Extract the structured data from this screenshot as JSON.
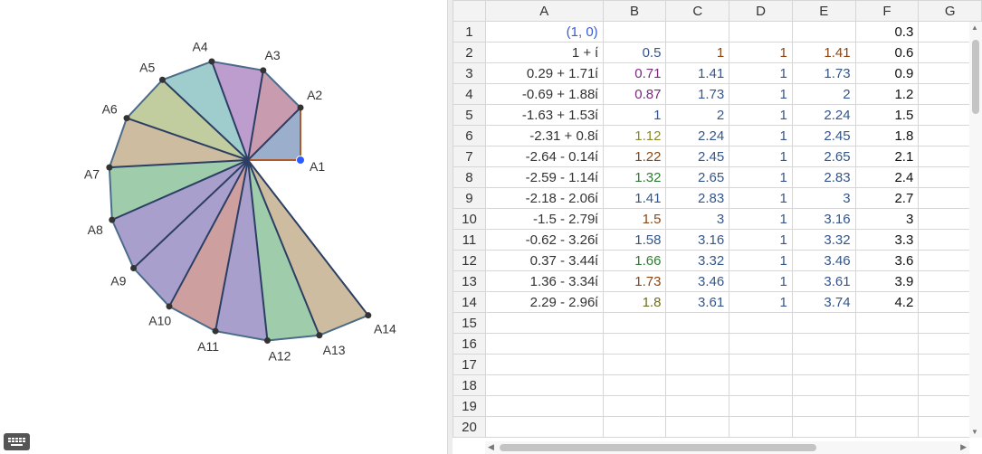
{
  "graphics": {
    "colors": {
      "edge": "#4a6b8a",
      "spoke": "#2c3e63",
      "point": "#333333",
      "selected_point": "#2d5bff",
      "first_triangle_edge": "#b05a2a",
      "fills": [
        "#8aa1c4",
        "#bf8aa0",
        "#b28cc4",
        "#8ec4c4",
        "#b6c48e",
        "#c4b08e",
        "#8ec49e",
        "#9a8ec4",
        "#9a8ec4",
        "#c48e8e",
        "#9a8ec4",
        "#8ec49e",
        "#c4b08e",
        "#b6c48e"
      ]
    },
    "points": [
      {
        "label": "A1",
        "selected": true
      },
      {
        "label": "A2"
      },
      {
        "label": "A3"
      },
      {
        "label": "A4"
      },
      {
        "label": "A5"
      },
      {
        "label": "A6"
      },
      {
        "label": "A7"
      },
      {
        "label": "A8"
      },
      {
        "label": "A9"
      },
      {
        "label": "A10"
      },
      {
        "label": "A11"
      },
      {
        "label": "A12"
      },
      {
        "label": "A13"
      },
      {
        "label": "A14"
      }
    ]
  },
  "keyboard": {
    "icon": "keyboard-icon"
  },
  "spreadsheet": {
    "columns": [
      "A",
      "B",
      "C",
      "D",
      "E",
      "F",
      "G"
    ],
    "rows": [
      {
        "n": "1",
        "A": "(1, 0)",
        "B": "",
        "C": "",
        "D": "",
        "E": "",
        "F": "0.3"
      },
      {
        "n": "2",
        "A": "1 + ί",
        "B": "0.5",
        "C": "1",
        "D": "1",
        "E": "1.41",
        "F": "0.6"
      },
      {
        "n": "3",
        "A": "0.29 + 1.71ί",
        "B": "0.71",
        "C": "1.41",
        "D": "1",
        "E": "1.73",
        "F": "0.9"
      },
      {
        "n": "4",
        "A": "-0.69 + 1.88ί",
        "B": "0.87",
        "C": "1.73",
        "D": "1",
        "E": "2",
        "F": "1.2"
      },
      {
        "n": "5",
        "A": "-1.63 + 1.53ί",
        "B": "1",
        "C": "2",
        "D": "1",
        "E": "2.24",
        "F": "1.5"
      },
      {
        "n": "6",
        "A": "-2.31 + 0.8ί",
        "B": "1.12",
        "C": "2.24",
        "D": "1",
        "E": "2.45",
        "F": "1.8"
      },
      {
        "n": "7",
        "A": "-2.64 - 0.14ί",
        "B": "1.22",
        "C": "2.45",
        "D": "1",
        "E": "2.65",
        "F": "2.1"
      },
      {
        "n": "8",
        "A": "-2.59 - 1.14ί",
        "B": "1.32",
        "C": "2.65",
        "D": "1",
        "E": "2.83",
        "F": "2.4"
      },
      {
        "n": "9",
        "A": "-2.18 - 2.06ί",
        "B": "1.41",
        "C": "2.83",
        "D": "1",
        "E": "3",
        "F": "2.7"
      },
      {
        "n": "10",
        "A": "-1.5 - 2.79ί",
        "B": "1.5",
        "C": "3",
        "D": "1",
        "E": "3.16",
        "F": "3"
      },
      {
        "n": "11",
        "A": "-0.62 - 3.26ί",
        "B": "1.58",
        "C": "3.16",
        "D": "1",
        "E": "3.32",
        "F": "3.3"
      },
      {
        "n": "12",
        "A": "0.37 - 3.44ί",
        "B": "1.66",
        "C": "3.32",
        "D": "1",
        "E": "3.46",
        "F": "3.6"
      },
      {
        "n": "13",
        "A": "1.36 - 3.34ί",
        "B": "1.73",
        "C": "3.46",
        "D": "1",
        "E": "3.61",
        "F": "3.9"
      },
      {
        "n": "14",
        "A": "2.29 - 2.96ί",
        "B": "1.8",
        "C": "3.61",
        "D": "1",
        "E": "3.74",
        "F": "4.2"
      },
      {
        "n": "15",
        "A": "",
        "B": "",
        "C": "",
        "D": "",
        "E": "",
        "F": ""
      },
      {
        "n": "16",
        "A": "",
        "B": "",
        "C": "",
        "D": "",
        "E": "",
        "F": ""
      },
      {
        "n": "17",
        "A": "",
        "B": "",
        "C": "",
        "D": "",
        "E": "",
        "F": ""
      },
      {
        "n": "18",
        "A": "",
        "B": "",
        "C": "",
        "D": "",
        "E": "",
        "F": ""
      },
      {
        "n": "19",
        "A": "",
        "B": "",
        "C": "",
        "D": "",
        "E": "",
        "F": ""
      },
      {
        "n": "20",
        "A": "",
        "B": "",
        "C": "",
        "D": "",
        "E": "",
        "F": ""
      }
    ],
    "cell_colors": {
      "A1": "#3a5bd9",
      "B": [
        "",
        "#34568b",
        "#7a2a7a",
        "#7a2a7a",
        "#34568b",
        "#8a8a2a",
        "#8b4513",
        "#2e7d32",
        "#34568b",
        "#8b4513",
        "#34568b",
        "#2e7d32",
        "#8b4513",
        "#6b6b20"
      ],
      "C": [
        "",
        "#8b4513",
        "#34568b",
        "#34568b",
        "#34568b",
        "#34568b",
        "#34568b",
        "#34568b",
        "#34568b",
        "#34568b",
        "#34568b",
        "#34568b",
        "#34568b",
        "#34568b"
      ],
      "D": [
        "",
        "#8b4513",
        "#34568b",
        "#34568b",
        "#34568b",
        "#34568b",
        "#34568b",
        "#34568b",
        "#34568b",
        "#34568b",
        "#34568b",
        "#34568b",
        "#34568b",
        "#34568b"
      ],
      "E": [
        "",
        "#8b4513",
        "#34568b",
        "#34568b",
        "#34568b",
        "#34568b",
        "#34568b",
        "#34568b",
        "#34568b",
        "#34568b",
        "#34568b",
        "#34568b",
        "#34568b",
        "#34568b"
      ],
      "A": "#333333",
      "F": "#111111"
    }
  }
}
